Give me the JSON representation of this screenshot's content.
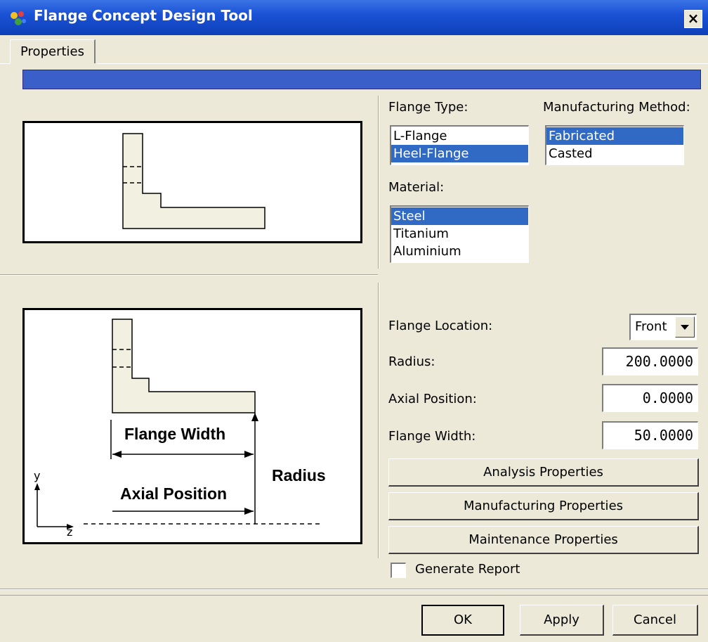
{
  "window": {
    "title": "Flange Concept Design Tool",
    "close_label": "×"
  },
  "tabs": [
    {
      "label": "Properties",
      "active": true
    }
  ],
  "progress": {
    "fraction": 1.0,
    "color": "#3a5fc8"
  },
  "flange_type": {
    "label": "Flange Type:",
    "options": [
      "L-Flange",
      "Heel-Flange"
    ],
    "selected": "Heel-Flange"
  },
  "manufacturing_method": {
    "label": "Manufacturing Method:",
    "options": [
      "Fabricated",
      "Casted"
    ],
    "selected": "Fabricated"
  },
  "material": {
    "label": "Material:",
    "options": [
      "Steel",
      "Titanium",
      "Aluminium"
    ],
    "selected": "Steel"
  },
  "diagram": {
    "flange_width_label": "Flange Width",
    "axial_position_label": "Axial Position",
    "radius_label": "Radius",
    "y_axis": "y",
    "z_axis": "z"
  },
  "fields": {
    "flange_location": {
      "label": "Flange Location:",
      "value": "Front"
    },
    "radius": {
      "label": "Radius:",
      "value": "200.0000"
    },
    "axial_position": {
      "label": "Axial Position:",
      "value": "0.0000"
    },
    "flange_width": {
      "label": "Flange Width:",
      "value": "50.0000"
    }
  },
  "property_buttons": {
    "analysis": "Analysis Properties",
    "manufacturing": "Manufacturing Properties",
    "maintenance": "Maintenance Properties"
  },
  "generate_report": {
    "label": "Generate Report",
    "checked": false
  },
  "footer": {
    "ok": "OK",
    "apply": "Apply",
    "cancel": "Cancel"
  },
  "colors": {
    "title_bar": "#1b52d6",
    "selection": "#316ac5",
    "dialog_bg": "#ece9d8"
  }
}
